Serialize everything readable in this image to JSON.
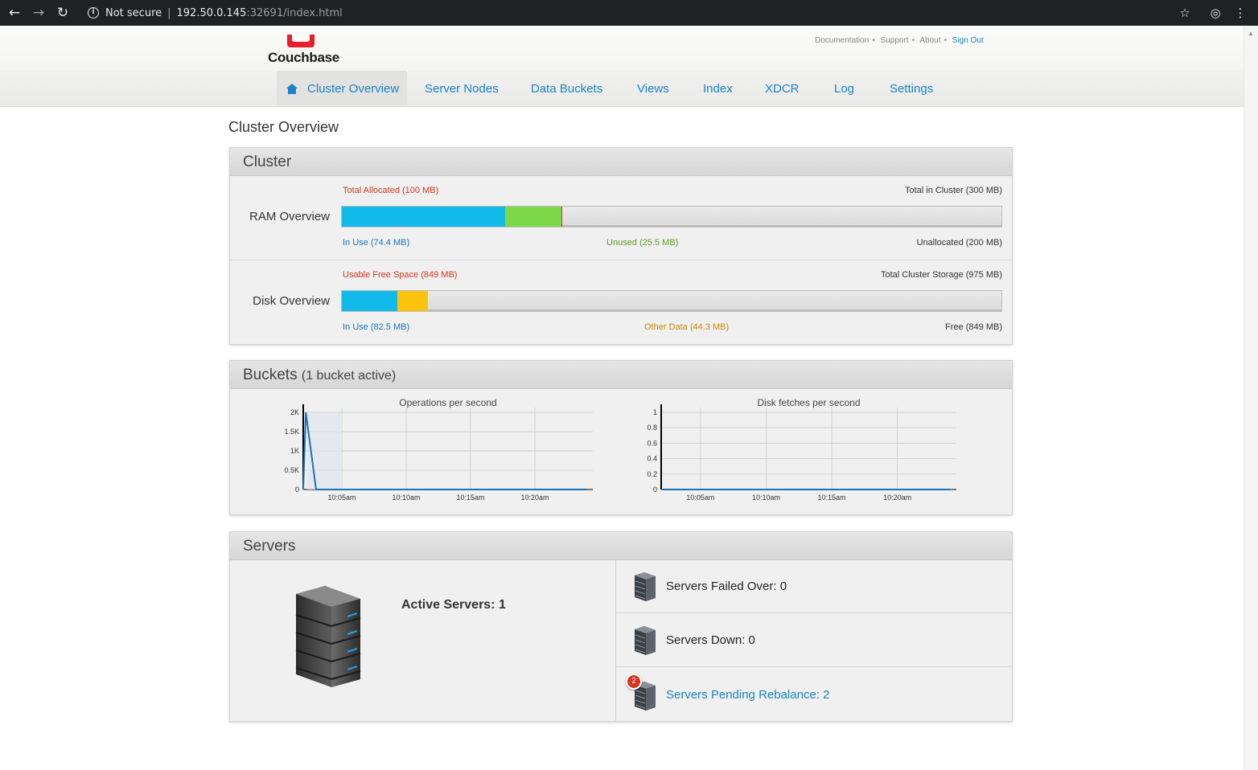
{
  "browser": {
    "not_secure": "Not secure",
    "url_host": "192.50.0.145",
    "url_rest": ":32691/index.html"
  },
  "header": {
    "logo_text": "Couchbase",
    "links": [
      "Documentation",
      "Support",
      "About"
    ],
    "sign_out": "Sign Out",
    "brand_color": "#e6202a"
  },
  "nav": {
    "tabs": [
      "Cluster Overview",
      "Server Nodes",
      "Data Buckets",
      "Views",
      "Index",
      "XDCR",
      "Log",
      "Settings"
    ],
    "active": "Cluster Overview"
  },
  "page_title": "Cluster Overview",
  "cluster": {
    "title": "Cluster",
    "ram": {
      "label": "RAM Overview",
      "top_left": "Total Allocated (100 MB)",
      "top_right": "Total in Cluster (300 MB)",
      "in_use": "In Use (74.4 MB)",
      "unused": "Unused (25.5 MB)",
      "unallocated": "Unallocated (200 MB)",
      "in_use_mb": 74.4,
      "unused_mb": 25.5,
      "total_mb": 300
    },
    "disk": {
      "label": "Disk Overview",
      "top_left": "Usable Free Space (849 MB)",
      "top_right": "Total Cluster Storage (975 MB)",
      "in_use": "In Use (82.5 MB)",
      "other": "Other Data (44.3 MB)",
      "free": "Free (849 MB)",
      "in_use_mb": 82.5,
      "other_mb": 44.3,
      "total_mb": 975
    },
    "colors": {
      "in_use": "#11bae8",
      "unused": "#7dd849",
      "other": "#fcc30e",
      "alloc_line": "#d6361f"
    }
  },
  "buckets": {
    "title": "Buckets",
    "subtitle": "(1 bucket active)"
  },
  "chart_data": [
    {
      "type": "area",
      "title": "Operations per second",
      "x_ticks": [
        "10:05am",
        "10:10am",
        "10:15am",
        "10:20am"
      ],
      "y_ticks": [
        "0",
        "0.5K",
        "1K",
        "1.5K",
        "2K"
      ],
      "ylim": [
        0,
        2000
      ],
      "series": [
        {
          "x": [
            0,
            0.2,
            1,
            5,
            10,
            15,
            20,
            22
          ],
          "y": [
            0,
            2000,
            0,
            0,
            0,
            0,
            0,
            0
          ]
        }
      ],
      "x_unit": "minutes after 10:02am"
    },
    {
      "type": "line",
      "title": "Disk fetches per second",
      "x_ticks": [
        "10:05am",
        "10:10am",
        "10:15am",
        "10:20am"
      ],
      "y_ticks": [
        "0",
        "0.2",
        "0.4",
        "0.6",
        "0.8",
        "1"
      ],
      "ylim": [
        0,
        1
      ],
      "series": [
        {
          "x": [
            0,
            22
          ],
          "y": [
            0,
            0
          ]
        }
      ]
    }
  ],
  "servers": {
    "title": "Servers",
    "active": "Active Servers: 1",
    "failed_over": "Servers Failed Over: 0",
    "down": "Servers Down: 0",
    "pending": "Servers Pending Rebalance: 2",
    "pending_badge": "2"
  }
}
